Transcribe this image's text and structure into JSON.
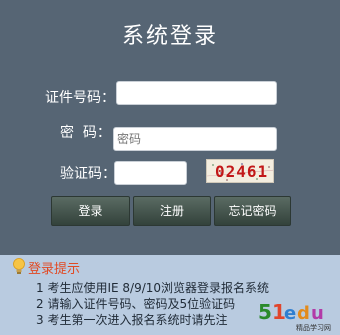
{
  "login": {
    "title": "系统登录",
    "id_label": "证件号码：",
    "id_value": "",
    "pwd_label": "密  码：",
    "pwd_placeholder": "密码",
    "code_label": "验证码：",
    "code_value": "",
    "captcha_text": "02461"
  },
  "buttons": {
    "login": "登录",
    "register": "注册",
    "forgot": "忘记密码"
  },
  "tips": {
    "title": "登录提示",
    "items": [
      "1 考生应使用IE 8/9/10浏览器登录报名系统",
      "2 请输入证件号码、密码及5位验证码",
      "3 考生第一次进入报名系统时请先注"
    ]
  },
  "watermark": {
    "brand": "51edu",
    "sub": "精品学习网"
  },
  "colors": {
    "panel_bg": "#566574",
    "tips_bg": "#b9cbe0",
    "tips_title": "#e14a24",
    "captcha_text": "#c21818"
  }
}
